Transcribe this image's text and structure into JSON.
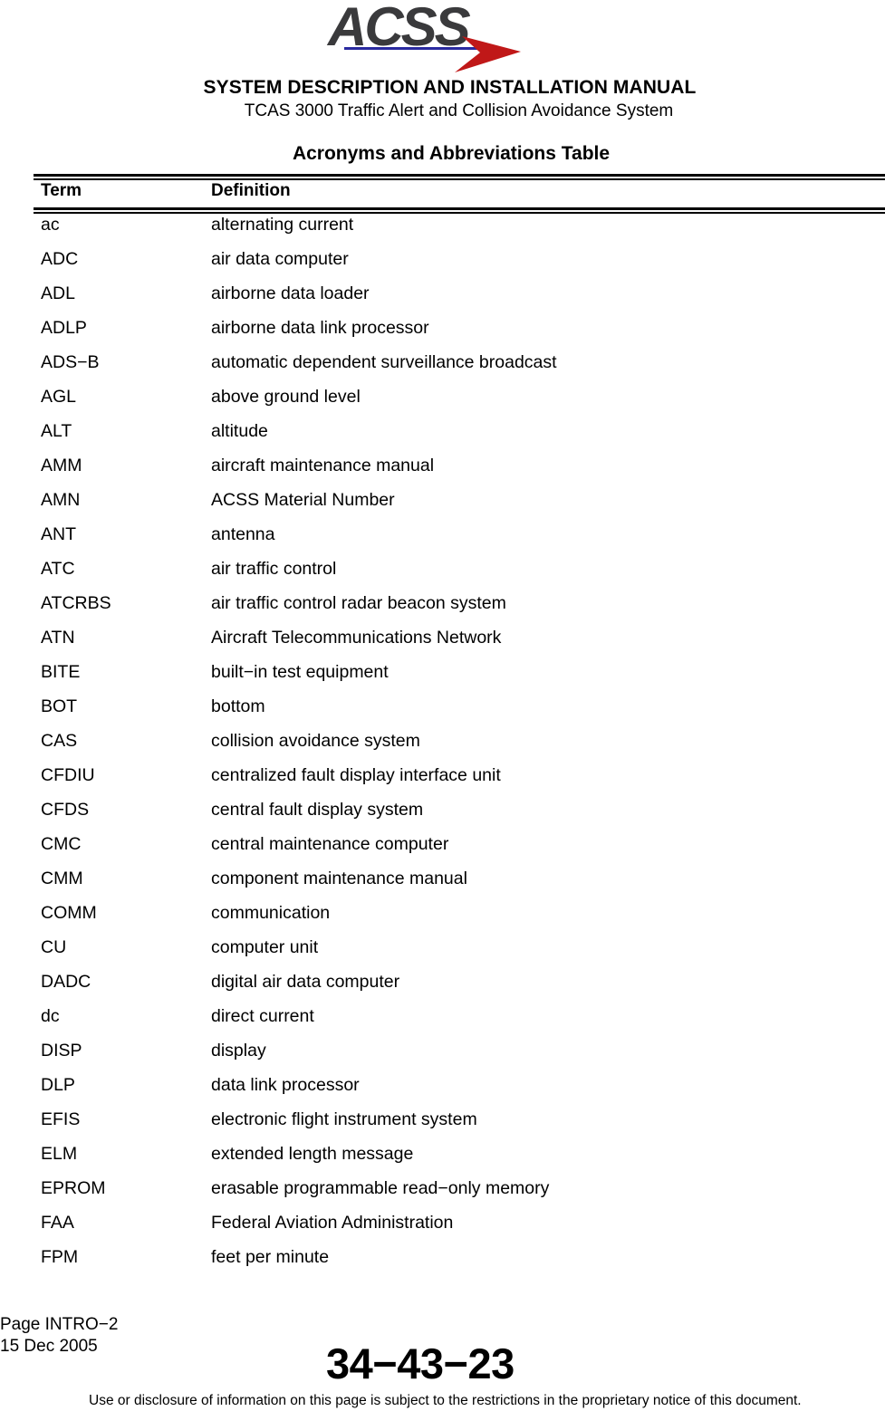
{
  "header": {
    "logo_text": "ACSS",
    "brand_colors": {
      "logo_text": "#3a3a3c",
      "logo_underline": "#2a2aa0",
      "logo_arrow": "#c01818"
    },
    "title": "SYSTEM DESCRIPTION AND INSTALLATION MANUAL",
    "subtitle": "TCAS 3000 Traffic Alert and Collision Avoidance System"
  },
  "table": {
    "title": "Acronyms and Abbreviations Table",
    "columns": [
      "Term",
      "Definition"
    ],
    "rows": [
      {
        "term": "ac",
        "definition": "alternating current"
      },
      {
        "term": "ADC",
        "definition": "air data computer"
      },
      {
        "term": "ADL",
        "definition": "airborne data loader"
      },
      {
        "term": "ADLP",
        "definition": "airborne data link processor"
      },
      {
        "term": "ADS−B",
        "definition": "automatic dependent surveillance broadcast"
      },
      {
        "term": "AGL",
        "definition": "above ground level"
      },
      {
        "term": "ALT",
        "definition": "altitude"
      },
      {
        "term": "AMM",
        "definition": "aircraft maintenance manual"
      },
      {
        "term": "AMN",
        "definition": "ACSS Material Number"
      },
      {
        "term": "ANT",
        "definition": "antenna"
      },
      {
        "term": "ATC",
        "definition": "air traffic control"
      },
      {
        "term": "ATCRBS",
        "definition": "air traffic control radar beacon system"
      },
      {
        "term": "ATN",
        "definition": "Aircraft Telecommunications Network"
      },
      {
        "term": "BITE",
        "definition": "built−in test equipment"
      },
      {
        "term": "BOT",
        "definition": "bottom"
      },
      {
        "term": "CAS",
        "definition": "collision avoidance system"
      },
      {
        "term": "CFDIU",
        "definition": "centralized fault display interface unit"
      },
      {
        "term": "CFDS",
        "definition": "central fault display system"
      },
      {
        "term": "CMC",
        "definition": "central maintenance computer"
      },
      {
        "term": "CMM",
        "definition": "component maintenance manual"
      },
      {
        "term": "COMM",
        "definition": "communication"
      },
      {
        "term": "CU",
        "definition": "computer unit"
      },
      {
        "term": "DADC",
        "definition": "digital air data computer"
      },
      {
        "term": "dc",
        "definition": "direct current"
      },
      {
        "term": "DISP",
        "definition": "display"
      },
      {
        "term": "DLP",
        "definition": "data link processor"
      },
      {
        "term": "EFIS",
        "definition": "electronic flight instrument system"
      },
      {
        "term": "ELM",
        "definition": "extended length message"
      },
      {
        "term": "EPROM",
        "definition": "erasable programmable read−only memory"
      },
      {
        "term": "FAA",
        "definition": "Federal Aviation Administration"
      },
      {
        "term": "FPM",
        "definition": "feet per minute"
      }
    ]
  },
  "footer": {
    "page": "Page INTRO−2",
    "date": "15 Dec 2005",
    "document_code": "34−43−23",
    "notice": "Use or disclosure of information on this page is subject to the restrictions in the proprietary notice of this document."
  }
}
